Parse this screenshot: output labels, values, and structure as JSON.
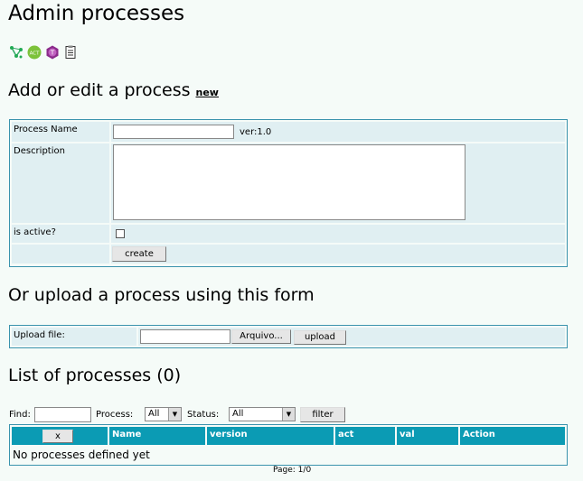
{
  "page": {
    "title": "Admin processes"
  },
  "toolbar": {
    "icons": [
      "process-graph-icon",
      "activities-icon",
      "templates-icon",
      "instances-icon"
    ],
    "icon_labels": [
      "ACT",
      "T"
    ]
  },
  "edit": {
    "heading": "Add or edit a process",
    "new_link": "new",
    "name_label": "Process Name",
    "name_value": "",
    "version_text": "ver:1.0",
    "description_label": "Description",
    "description_value": "",
    "active_label": "is active?",
    "active_checked": false,
    "create_label": "create"
  },
  "upload": {
    "heading": "Or upload a process using this form",
    "file_label": "Upload file:",
    "browse_label": "Arquivo...",
    "upload_label": "upload"
  },
  "list": {
    "heading": "List of processes (0)",
    "find_label": "Find:",
    "find_value": "",
    "process_label": "Process:",
    "process_value": "All",
    "status_label": "Status:",
    "status_value": "All",
    "filter_label": "filter",
    "columns": [
      "x",
      "Name",
      "version",
      "act",
      "val",
      "Action"
    ],
    "empty_text": "No processes defined yet",
    "pagination": "Page: 1/0"
  },
  "colors": {
    "header_bg": "#0b9bb4",
    "row_bg": "#e0eff2",
    "border": "#3a93ad",
    "page_bg": "#f5fbf8"
  }
}
